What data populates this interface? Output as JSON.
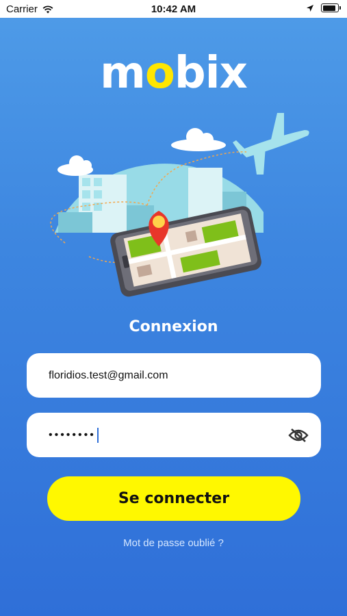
{
  "status_bar": {
    "carrier": "Carrier",
    "time": "10:42 AM",
    "icons": [
      "wifi-icon",
      "location-arrow-icon",
      "battery-icon"
    ]
  },
  "logo": {
    "part1": "m",
    "o": "o",
    "part2": "bix",
    "accent_color": "#ffe600"
  },
  "login": {
    "title": "Connexion",
    "email_value": "floridios.test@gmail.com",
    "password_masked": "••••••••",
    "toggle_icon": "eye-off-icon",
    "submit_label": "Se connecter",
    "forgot_password": "Mot de passe oublié ?"
  },
  "colors": {
    "background_top": "#4f9ce8",
    "background_bottom": "#2f6fd8",
    "button": "#fff800"
  }
}
